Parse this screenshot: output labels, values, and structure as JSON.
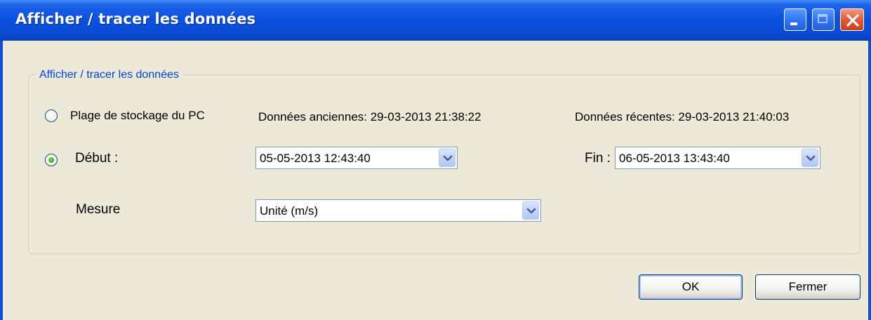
{
  "window": {
    "title": "Afficher / tracer les données"
  },
  "group": {
    "label": "Afficher / tracer les données"
  },
  "pc_range": {
    "radio_label": "Plage de stockage du PC",
    "selected": false,
    "old_data": "Données anciennes:  29-03-2013 21:38:22",
    "recent_data": "Données récentes: 29-03-2013 21:40:03"
  },
  "range": {
    "selected": true,
    "start_label": "Début :",
    "start_value": "05-05-2013 12:43:40",
    "end_label": "Fin :",
    "end_value": "06-05-2013 13:43:40"
  },
  "measure": {
    "label": "Mesure",
    "value": "Unité (m/s)"
  },
  "buttons": {
    "ok": "OK",
    "close": "Fermer"
  },
  "colors": {
    "titlebar": "#0a52e2",
    "dialog_bg": "#ece9d8",
    "group_label": "#0046d5",
    "radio_selected": "#2ea81a"
  }
}
